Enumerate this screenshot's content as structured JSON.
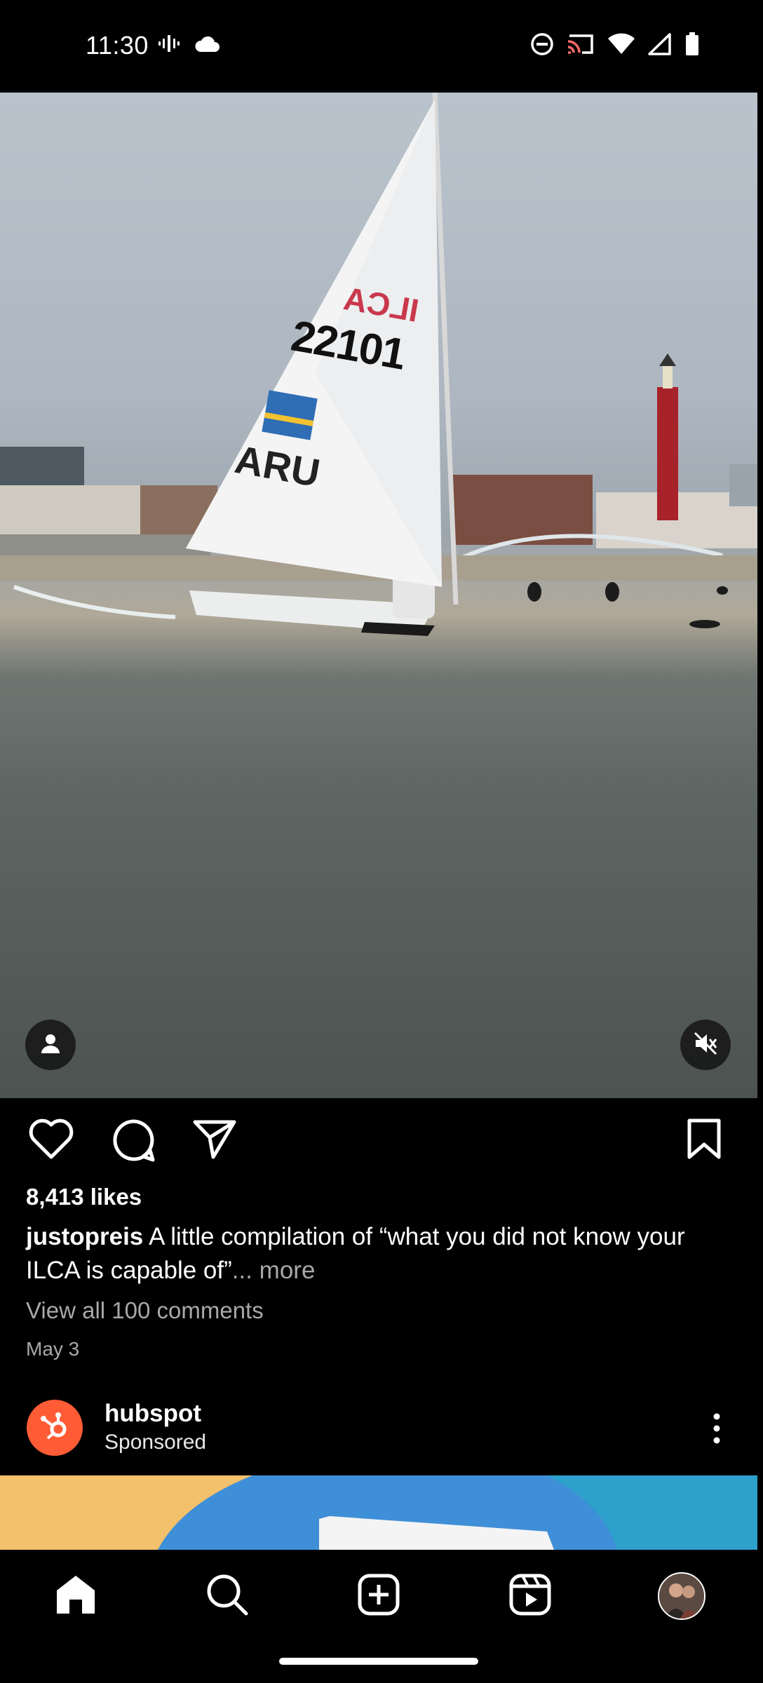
{
  "status_bar": {
    "time": "11:30",
    "left_icons": [
      "vibrate-icon",
      "cloud-icon"
    ],
    "right_icons": [
      "do-not-disturb-icon",
      "cast-icon",
      "wifi-icon",
      "cell-signal-icon",
      "battery-icon"
    ]
  },
  "post": {
    "media_controls": {
      "profile_tag_icon": "person-icon",
      "mute_icon": "speaker-muted-icon"
    },
    "sail_text": {
      "class": "ILCA",
      "number": "22101",
      "country": "ARU"
    },
    "actions": [
      "heart-icon",
      "comment-icon",
      "share-icon",
      "bookmark-icon"
    ],
    "likes": "8,413 likes",
    "username": "justopreis",
    "caption": "A little compilation of “what you did not know your ILCA is capable of”",
    "more_label": "... more",
    "view_comments": "View all 100 comments",
    "date": "May 3"
  },
  "sponsored": {
    "name": "hubspot",
    "label": "Sponsored",
    "menu_icon": "more-vertical-icon"
  },
  "bottom_nav": {
    "items": [
      "home-icon",
      "search-icon",
      "create-icon",
      "reels-icon",
      "profile-avatar"
    ]
  }
}
